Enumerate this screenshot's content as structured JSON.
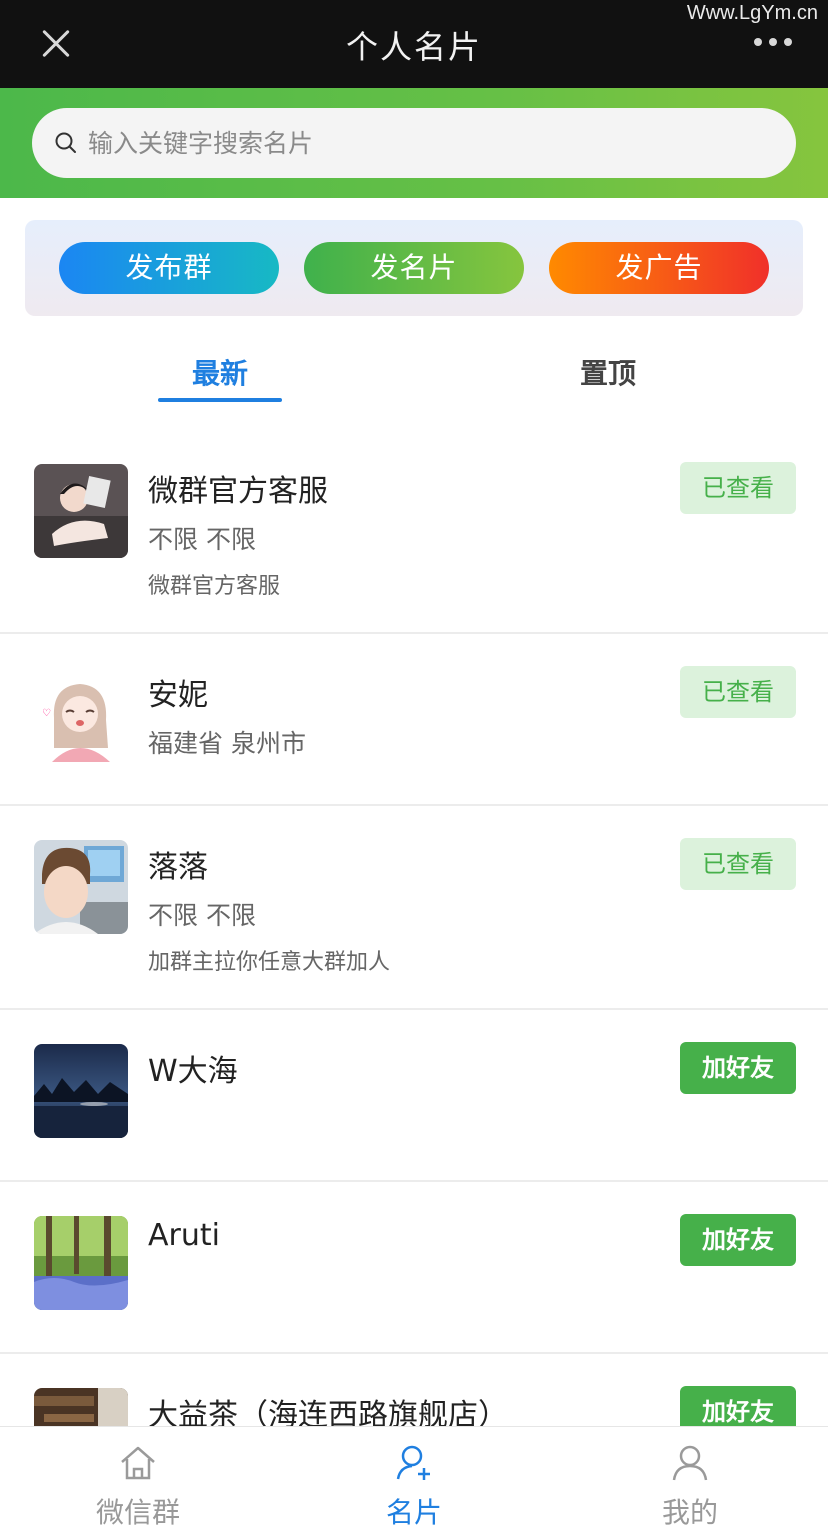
{
  "watermark": "Www.LgYm.cn",
  "header": {
    "title": "个人名片",
    "close_icon": "close-icon",
    "more_icon": "more-dots-icon"
  },
  "search": {
    "placeholder": "输入关键字搜索名片",
    "value": ""
  },
  "actions": {
    "publish_group": "发布群",
    "publish_card": "发名片",
    "publish_ad": "发广告"
  },
  "tabs": [
    {
      "label": "最新",
      "active": true
    },
    {
      "label": "置顶",
      "active": false
    }
  ],
  "cards": [
    {
      "name": "微群官方客服",
      "location": "不限 不限",
      "description": "微群官方客服",
      "status": "已查看"
    },
    {
      "name": "安妮",
      "location": "福建省 泉州市",
      "description": "",
      "status": "已查看"
    },
    {
      "name": "落落",
      "location": "不限 不限",
      "description": "加群主拉你任意大群加人",
      "status": "已查看"
    },
    {
      "name": "W大海",
      "location": "",
      "description": "",
      "status": "加好友"
    },
    {
      "name": "Aruti",
      "location": "",
      "description": "",
      "status": "加好友"
    },
    {
      "name": "大益茶（海连西路旗舰店）",
      "location": "",
      "description": "",
      "status": "加好友"
    }
  ],
  "bottom_nav": [
    {
      "label": "微信群",
      "icon": "home-icon",
      "active": false
    },
    {
      "label": "名片",
      "icon": "add-contact-icon",
      "active": true
    },
    {
      "label": "我的",
      "icon": "user-icon",
      "active": false
    }
  ],
  "colors": {
    "accent_blue": "#1f7fe0",
    "brand_green": "#46b04a",
    "topbar": "#111111"
  }
}
